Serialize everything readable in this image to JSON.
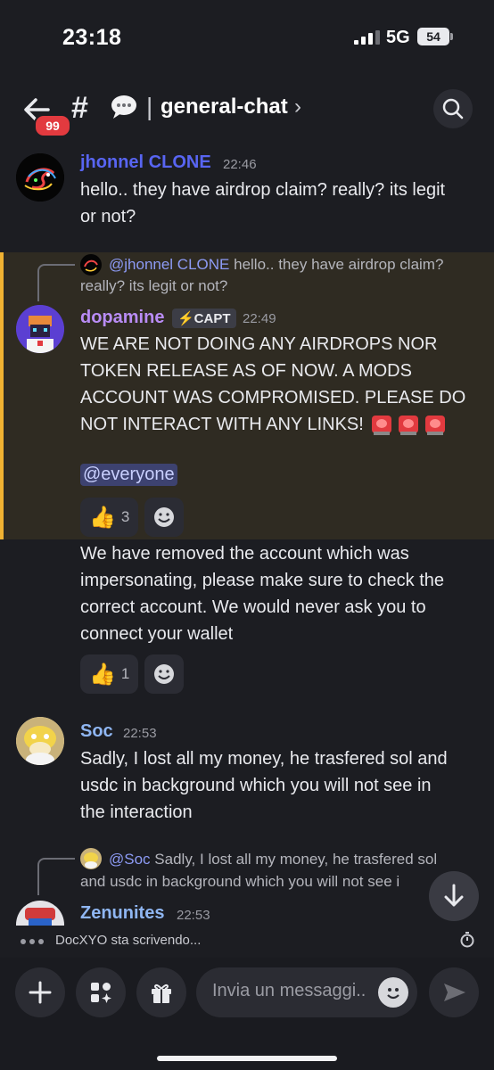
{
  "status_bar": {
    "time": "23:18",
    "network": "5G",
    "battery": "54"
  },
  "header": {
    "badge": "99",
    "hash": "#",
    "channel_separator": "|",
    "channel_name": "general-chat",
    "chevron": "›"
  },
  "messages": [
    {
      "author": "jhonnel CLONE",
      "author_color": "#5865f2",
      "time": "22:46",
      "lines": [
        "hello.. they have airdrop claim? really? its legit",
        "or not?"
      ]
    },
    {
      "reply_to": "@jhonnel CLONE",
      "reply_preview_1": "hello.. they have airdrop claim?",
      "reply_preview_2": "really? its legit or not?",
      "author": "dopamine",
      "author_color": "#b98cf5",
      "tag": "⚡CAPT",
      "time": "22:49",
      "lines": [
        "WE ARE NOT DOING ANY AIRDROPS NOR",
        "TOKEN RELEASE AS OF NOW. A MODS",
        "ACCOUNT WAS COMPROMISED. PLEASE DO",
        "NOT INTERACT WITH ANY LINKS!"
      ],
      "mention": "@everyone",
      "reaction_emoji": "👍",
      "reaction_count": "3"
    },
    {
      "lines": [
        "We have removed the account which was",
        "impersonating, please make sure to check the",
        "correct account. We would never ask you to",
        "connect your wallet"
      ],
      "reaction_emoji": "👍",
      "reaction_count": "1"
    },
    {
      "author": "Soc",
      "author_color": "#8fb6f2",
      "time": "22:53",
      "lines": [
        "Sadly, I lost all my money, he trasfered sol and",
        "usdc in background which you will not see in",
        "the interaction"
      ]
    },
    {
      "reply_to": "@Soc",
      "reply_preview_1": "Sadly, I lost all my money, he trasfered sol",
      "reply_preview_2": "and usdc in background which you will not see i",
      "author": "Zenunites",
      "author_color": "#8fb6f2",
      "time": "22:53"
    }
  ],
  "typing_indicator": "DocXYO sta scrivendo...",
  "composer": {
    "placeholder": "Invia un messaggi.."
  }
}
